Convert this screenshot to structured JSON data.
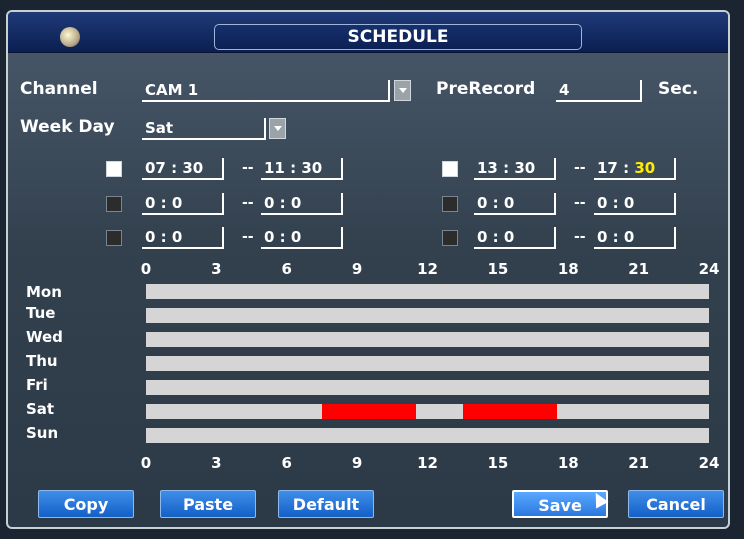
{
  "window": {
    "title": "SCHEDULE"
  },
  "channel": {
    "label": "Channel",
    "value": "CAM 1"
  },
  "prerecord": {
    "label": "PreRecord",
    "value": "4",
    "unit": "Sec."
  },
  "weekday": {
    "label": "Week Day",
    "value": "Sat"
  },
  "periods": [
    {
      "enabled": true,
      "start_h": "07",
      "start_m": "30",
      "end_h": "11",
      "end_m": "30"
    },
    {
      "enabled": false,
      "start_h": "0",
      "start_m": "0",
      "end_h": "0",
      "end_m": "0"
    },
    {
      "enabled": false,
      "start_h": "0",
      "start_m": "0",
      "end_h": "0",
      "end_m": "0"
    },
    {
      "enabled": true,
      "start_h": "13",
      "start_m": "30",
      "end_h": "17",
      "end_m": "30"
    },
    {
      "enabled": false,
      "start_h": "0",
      "start_m": "0",
      "end_h": "0",
      "end_m": "0"
    },
    {
      "enabled": false,
      "start_h": "0",
      "start_m": "0",
      "end_h": "0",
      "end_m": "0"
    }
  ],
  "timeline": {
    "hour_ticks": [
      "0",
      "3",
      "6",
      "9",
      "12",
      "15",
      "18",
      "21",
      "24"
    ],
    "days": [
      "Mon",
      "Tue",
      "Wed",
      "Thu",
      "Fri",
      "Sat",
      "Sun"
    ],
    "bar_color": "#d5d5d5",
    "record_color": "#ff0000",
    "schedule": {
      "Sat": [
        {
          "start": 7.5,
          "end": 11.5
        },
        {
          "start": 13.5,
          "end": 17.5
        }
      ]
    }
  },
  "buttons": {
    "copy": "Copy",
    "paste": "Paste",
    "default": "Default",
    "save": "Save",
    "cancel": "Cancel"
  },
  "separator": "--",
  "colon": ":"
}
